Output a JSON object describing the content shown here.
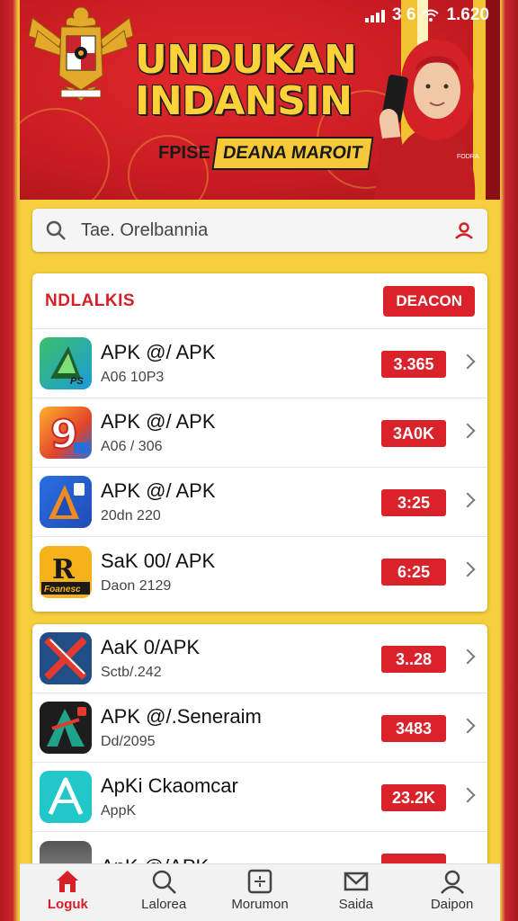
{
  "status_bar": {
    "time": "1.620",
    "extra": "3 6"
  },
  "banner": {
    "headline_line1": "UNDUKAN",
    "headline_line2": "INDANSIN",
    "sub_left": "FPISE",
    "sub_right": "DEANA MAROIT",
    "phone_tag": "FODRA"
  },
  "search": {
    "placeholder": "Tae. Orelbannia"
  },
  "card1": {
    "title": "NDLALKIS",
    "action": "DEACON",
    "rows": [
      {
        "name": "APK @/ APK",
        "sub": "A06 10P3",
        "badge": "3.365",
        "icon": "play-triangle-icon",
        "icon_text": "PS"
      },
      {
        "name": "APK @/ APK",
        "sub": "A06 / 306",
        "badge": "3A0K",
        "icon": "nine-icon",
        "icon_text": "9"
      },
      {
        "name": "APK @/ APK",
        "sub": "20dn 220",
        "badge": "3:25",
        "icon": "triangle-a-icon",
        "icon_text": ""
      },
      {
        "name": "SaK 00/ APK",
        "sub": "Daon 2129",
        "badge": "6:25",
        "icon": "r-logo-icon",
        "icon_text": "R",
        "icon_caption": "Foanesc"
      }
    ]
  },
  "card2": {
    "rows": [
      {
        "name": "AaK 0/APK",
        "sub": "Sctb/.242",
        "badge": "3..28",
        "icon": "cross-slash-icon"
      },
      {
        "name": "APK @/.Seneraim",
        "sub": "Dd/2095",
        "badge": "3483",
        "icon": "a-delta-icon"
      },
      {
        "name": "ApKi Ckaomcar",
        "sub": "AppK",
        "badge": "23.2K",
        "icon": "a-outline-icon"
      },
      {
        "name": "AnK @/APK",
        "sub": "",
        "badge": "",
        "icon": "grey-box-icon"
      }
    ]
  },
  "nav": [
    {
      "label": "Loguk",
      "icon": "home-icon",
      "active": true
    },
    {
      "label": "Lalorea",
      "icon": "search-icon",
      "active": false
    },
    {
      "label": "Morumon",
      "icon": "apps-icon",
      "active": false
    },
    {
      "label": "Saida",
      "icon": "mail-icon",
      "active": false
    },
    {
      "label": "Daipon",
      "icon": "person-icon",
      "active": false
    }
  ],
  "colors": {
    "accent": "#d9222a",
    "banner": "#c81c22",
    "gold": "#f6cf3f"
  }
}
